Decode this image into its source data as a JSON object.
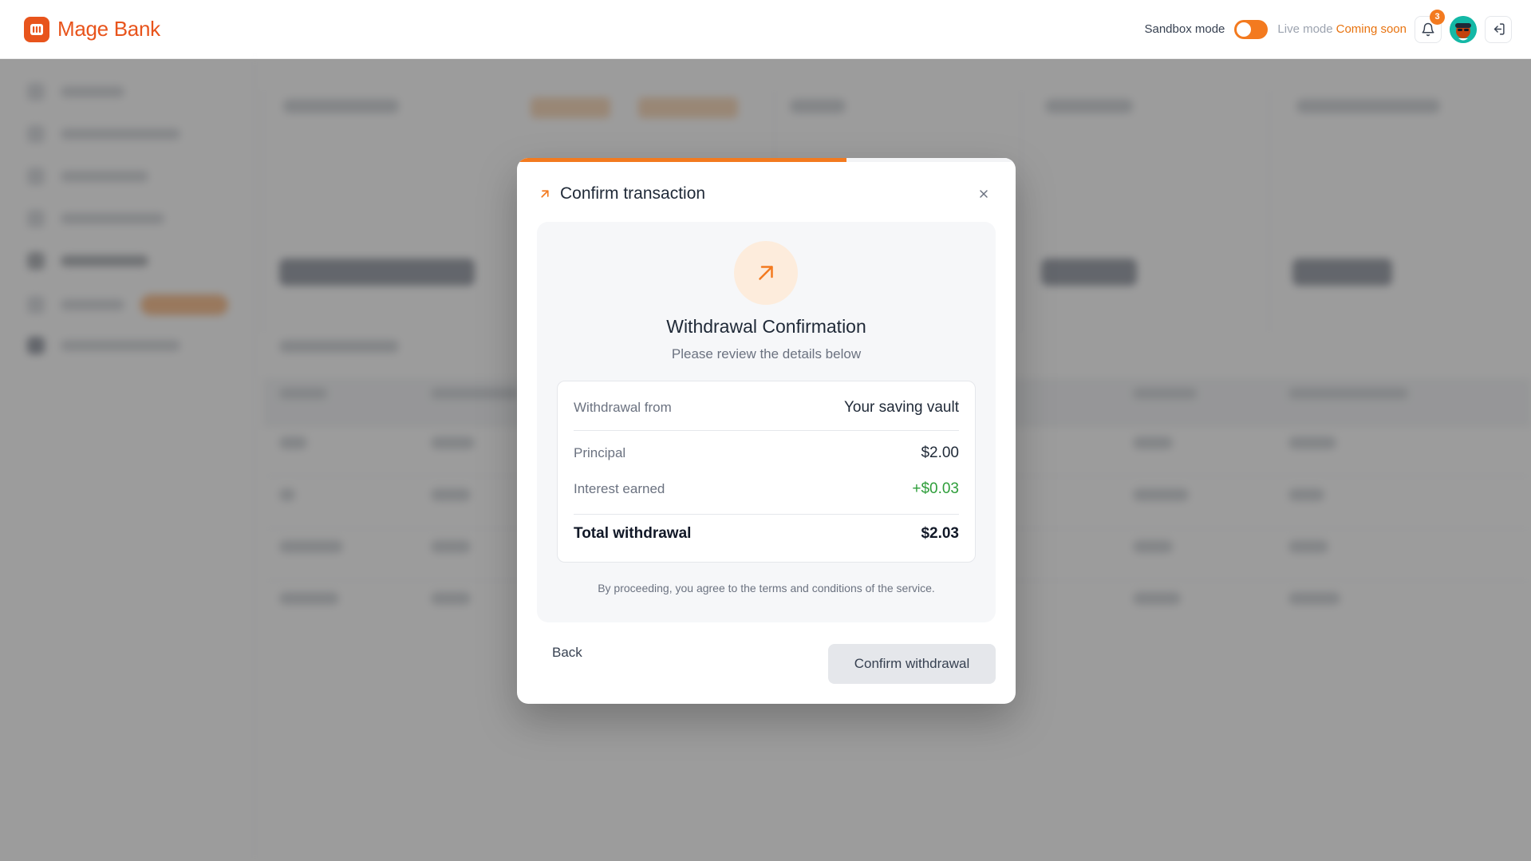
{
  "header": {
    "brand": "Mage Bank",
    "sandbox_label": "Sandbox mode",
    "live_label": "Live mode",
    "coming_soon": "Coming soon",
    "notification_count": "3",
    "accent_color": "#f37a1f"
  },
  "modal": {
    "title": "Confirm transaction",
    "progress_percent": 66,
    "heading": "Withdrawal Confirmation",
    "subheading": "Please review the details below",
    "rows": {
      "from_label": "Withdrawal from",
      "from_value": "Your saving vault",
      "principal_label": "Principal",
      "principal_value": "$2.00",
      "interest_label": "Interest earned",
      "interest_value": "+$0.03",
      "total_label": "Total withdrawal",
      "total_value": "$2.03"
    },
    "terms": "By proceeding, you agree to the terms and conditions of the service.",
    "back_label": "Back",
    "confirm_label": "Confirm withdrawal",
    "icons": {
      "title": "arrow-up-right-icon",
      "close": "close-icon",
      "hero": "arrow-up-right-icon"
    }
  }
}
